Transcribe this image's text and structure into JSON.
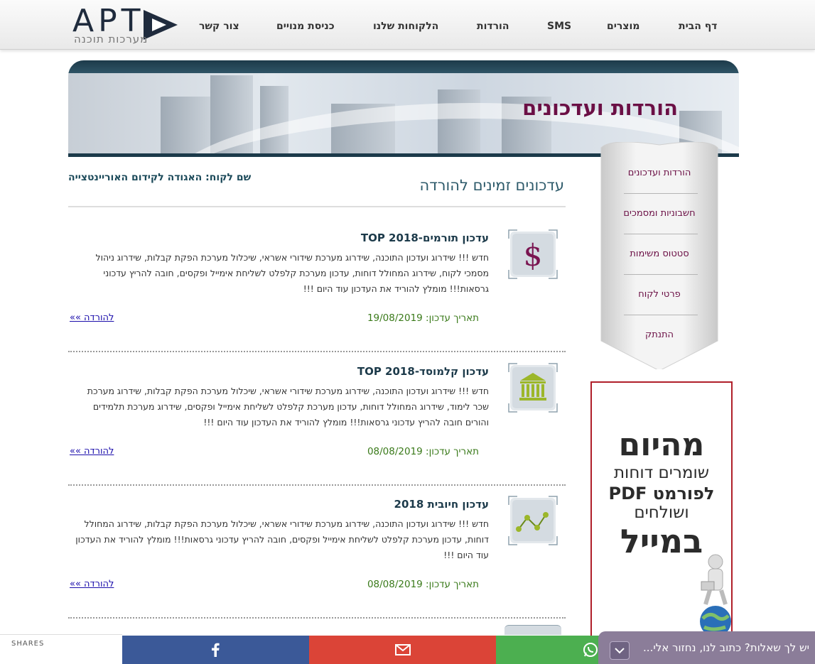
{
  "nav": {
    "logo_text": "APT",
    "logo_sub": "מערכות תוכנה",
    "items": [
      "דף הבית",
      "מוצרים",
      "SMS",
      "הורדות",
      "הלקוחות שלנו",
      "כניסת מנויים",
      "צור קשר"
    ]
  },
  "banner": {
    "title": "הורדות ועדכונים"
  },
  "sidebar": {
    "items": [
      "הורדות ועדכונים",
      "חשבוניות ומסמכים",
      "סטטוס משימות",
      "פרטי לקוח",
      "התנתק"
    ]
  },
  "promo": {
    "line1": "מהיום",
    "line2": "שומרים דוחות",
    "line3": "לפורמט PDF",
    "line4": "ושולחים",
    "line5": "במייל"
  },
  "client": {
    "label": "שם לקוח:",
    "name": "האגודה לקידום האוריינטצייה"
  },
  "page": {
    "heading": "עדכונים זמינים להורדה"
  },
  "updates": [
    {
      "icon": "dollar-icon",
      "title": "עדכון תורמים-TOP 2018",
      "description": "חדש !!! שידרוג ועדכון התוכנה, שידרוג מערכת שידורי אשראי, שיכלול מערכת הפקת קבלות, שידרוג ניהול מסמכי לקוח, שידרוג המחולל דוחות, עדכון מערכת קלפלט לשליחת אימייל ופקסים, חובה להריץ עדכוני גרסאות!!! מומלץ להוריד את העדכון עוד היום !!!",
      "date_label": "תאריך עדכון:",
      "date": "19/08/2019",
      "download": "להורדה »»"
    },
    {
      "icon": "bank-icon",
      "title": "עדכון קלמוסד-TOP 2018",
      "description": "חדש !!! שידרוג ועדכון התוכנה, שידרוג מערכת שידורי אשראי, שיכלול מערכת הפקת קבלות, שידרוג מערכת שכר לימוד, שידרוג המחולל דוחות, עדכון מערכת קלפלט לשליחת אימייל ופקסים, שידרוג מערכת תלמידים והורים חובה להריץ עדכוני גרסאות!!! מומלץ להוריד את העדכון עוד היום !!!",
      "date_label": "תאריך עדכון:",
      "date": "08/08/2019",
      "download": "להורדה »»"
    },
    {
      "icon": "chart-icon",
      "title": "עדכון חיובית 2018",
      "description": "חדש !!! שידרוג ועדכון התוכנה, שידרוג מערכת שידורי אשראי, שיכלול מערכת הפקת קבלות, שידרוג המחולל דוחות, עדכון מערכת קלפלט לשליחת אימייל ופקסים, חובה להריץ עדכוני גרסאות!!! מומלץ להוריד את העדכון עוד היום !!!",
      "date_label": "תאריך עדכון:",
      "date": "08/08/2019",
      "download": "להורדה »»"
    }
  ],
  "sharebar": {
    "label": "SHARES",
    "colors": {
      "facebook": "#3b5998",
      "gmail": "#db4437",
      "whatsapp": "#4caf50"
    }
  },
  "chat": {
    "text": "יש לך שאלות? כתוב לנו, נחזור אלי..."
  }
}
